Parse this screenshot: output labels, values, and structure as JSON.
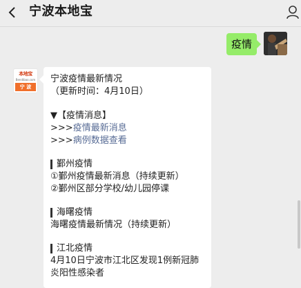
{
  "header": {
    "title": "宁波本地宝"
  },
  "chat": {
    "outgoing": {
      "text": "疫情"
    },
    "incoming": {
      "brand": {
        "top": "本地宝",
        "mid": "Bendibao.com",
        "bottom": "宁 波"
      },
      "lines": {
        "l1": "宁波疫情最新情况",
        "l2": "（更新时间：4月10日）",
        "l3_prefix": "▼【",
        "l3_text": "疫情消息",
        "l3_suffix": "】",
        "l4_prefix": ">>>",
        "l4_link": "疫情最新消息",
        "l5_prefix": ">>>",
        "l5_link": "病例数据查看",
        "s1_head": "鄞州疫情",
        "s1_item1": "①鄞州疫情最新消息（持续更新）",
        "s1_item2": "②鄞州区部分学校/幼儿园停课",
        "s2_head": "海曙疫情",
        "s2_item1": "海曙疫情最新情况（持续更新）",
        "s3_head": "江北疫情",
        "s3_item1": "4月10日宁波市江北区发现1例新冠肺",
        "s3_item1b": "炎阳性感染者"
      }
    }
  }
}
